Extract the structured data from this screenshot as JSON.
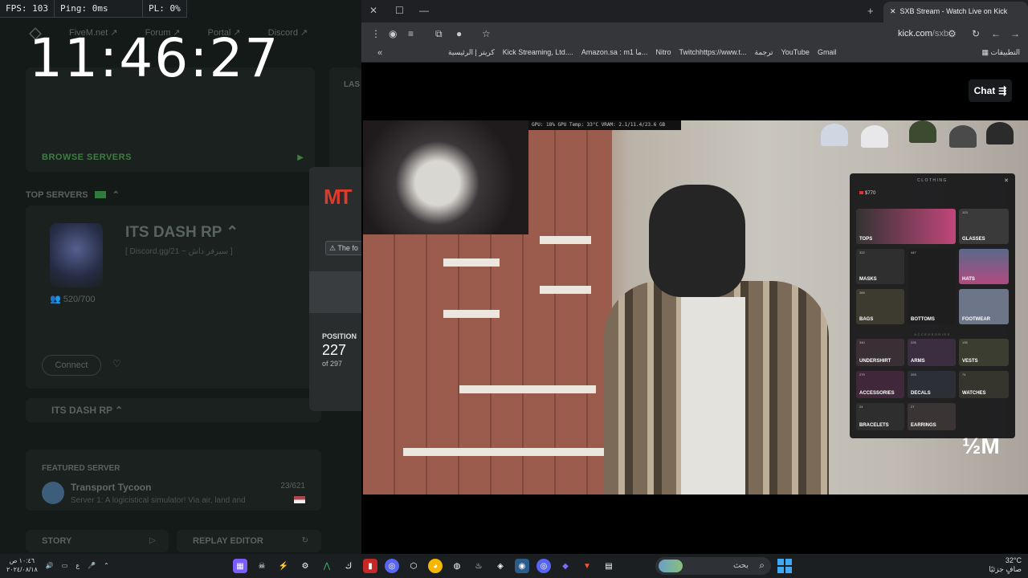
{
  "perf": {
    "fps": "FPS: 103",
    "ping": "Ping: 0ms",
    "pl": "PL: 0%"
  },
  "clock": "11:46:27",
  "fivem": {
    "nav": [
      "FiveM.net ↗",
      "Forum ↗",
      "Portal ↗",
      "Discord ↗"
    ],
    "browse_servers": "BROWSE SERVERS",
    "last_label": "LAS",
    "top_servers": "TOP SERVERS",
    "server": {
      "name": "ITS DASH RP ⌃",
      "discord": "[ Discord.gg/21 ~ سيرفر داش ]",
      "players": "520/700",
      "connect": "Connect"
    },
    "server_bar_name": "ITS DASH RP ⌃",
    "featured": {
      "label": "FEATURED SERVER",
      "name": "Transport Tycoon",
      "desc": "Server 1: A logicistical simulator! Via air, land and",
      "count": "23/621"
    },
    "story": "STORY",
    "replay": "REPLAY EDITOR",
    "modal": {
      "logo": "MT",
      "notice": "The fo",
      "position_label": "POSITION",
      "position": "227",
      "of": "of 297"
    }
  },
  "browser": {
    "tab_title": "SXB Stream - Watch Live on Kick",
    "url_host": "kick.com",
    "url_path": "/sxb",
    "bookmarks": [
      "كريتر | الرئيسية",
      "Kick Streaming, Ltd....",
      "Amazon.sa : m1 ما...",
      "Nitro",
      "Twitchhttps://www.t...",
      "ترجمة",
      "YouTube",
      "Gmail"
    ],
    "apps_label": "التطبيقات",
    "chat_label": "Chat"
  },
  "stream": {
    "gpu_overlay": "GPU: 18%   GPU Temp: 33°C  VRAM: 2.1/11.4/23.6 GB",
    "clothing": {
      "title": "CLOTHING",
      "cash": "$770",
      "categories": [
        {
          "label": "TOPS",
          "count": ""
        },
        {
          "label": "GLASSES",
          "count": "123"
        },
        {
          "label": "MASKS",
          "count": "322"
        },
        {
          "label": "BOTTOMS",
          "count": "447"
        },
        {
          "label": "HATS",
          "count": ""
        },
        {
          "label": "BAGS",
          "count": "269"
        },
        {
          "label": "FOOTWEAR",
          "count": ""
        }
      ],
      "accessories_label": "ACCESSORIES",
      "accessories": [
        {
          "label": "UNDERSHIRT",
          "count": "340"
        },
        {
          "label": "ARMS",
          "count": "226"
        },
        {
          "label": "VESTS",
          "count": "135"
        },
        {
          "label": "ACCESSORIES",
          "count": "279"
        },
        {
          "label": "DECALS",
          "count": "293"
        },
        {
          "label": "WATCHES",
          "count": "74"
        },
        {
          "label": "BRACELETS",
          "count": "24"
        },
        {
          "label": "EARRINGS",
          "count": "27"
        }
      ]
    },
    "watermark": "½M"
  },
  "taskbar": {
    "time": "١٠:٤٦ ص",
    "date": "٢٠٢٤/٠٨/١٨",
    "lang": "ع",
    "search_placeholder": "بحث",
    "weather_temp": "32°C",
    "weather_desc": "صافٍ جزئيًا"
  }
}
